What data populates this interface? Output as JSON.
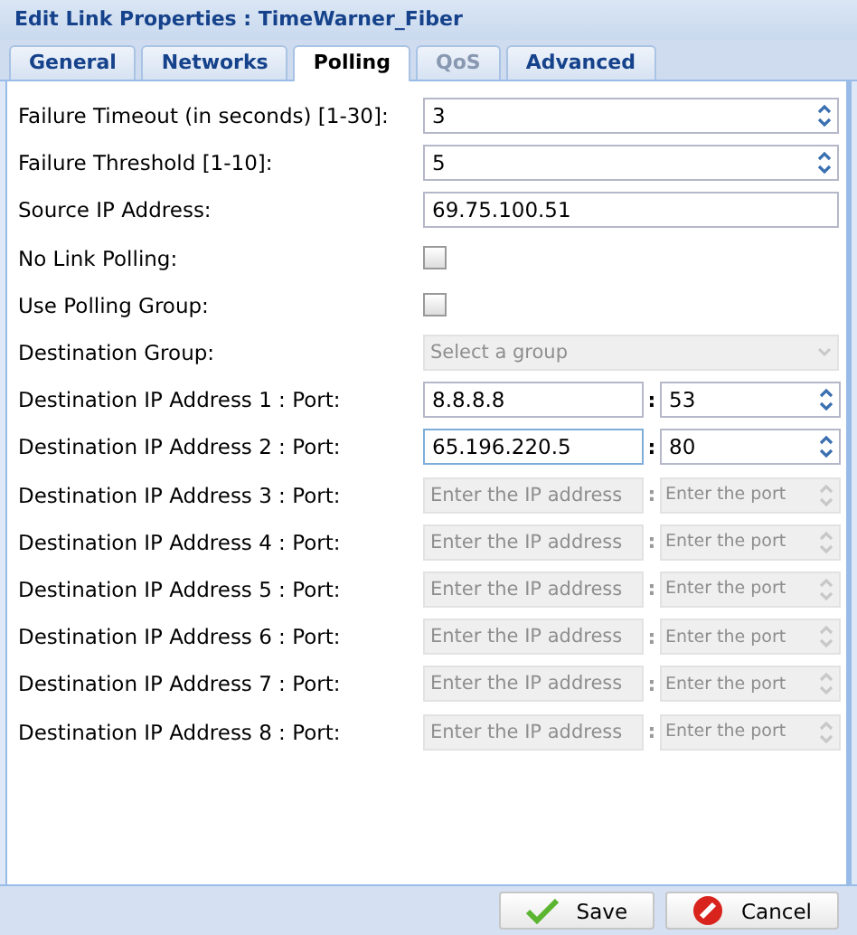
{
  "window": {
    "title": "Edit Link Properties : TimeWarner_Fiber"
  },
  "tabs": [
    {
      "label": "General",
      "selected": false,
      "disabled": false
    },
    {
      "label": "Networks",
      "selected": false,
      "disabled": false
    },
    {
      "label": "Polling",
      "selected": true,
      "disabled": false
    },
    {
      "label": "QoS",
      "selected": false,
      "disabled": true
    },
    {
      "label": "Advanced",
      "selected": false,
      "disabled": false
    }
  ],
  "fields": [
    {
      "kind": "spinner",
      "label": "Failure Timeout (in seconds) [1-30]:",
      "value": "3"
    },
    {
      "kind": "spinner",
      "label": "Failure Threshold [1-10]:",
      "value": "5"
    },
    {
      "kind": "text",
      "label": "Source IP Address:",
      "value": "69.75.100.51"
    },
    {
      "kind": "checkbox",
      "label": "No Link Polling:",
      "checked": false
    },
    {
      "kind": "checkbox",
      "label": "Use Polling Group:",
      "checked": false
    },
    {
      "kind": "select",
      "label": "Destination Group:",
      "placeholder": "Select a group",
      "disabled": true
    },
    {
      "kind": "ip-port",
      "label": "Destination IP Address 1 : Port:",
      "ip": "8.8.8.8",
      "separator": ":",
      "port": "53",
      "disabled": false,
      "focused": false
    },
    {
      "kind": "ip-port",
      "label": "Destination IP Address 2 : Port:",
      "ip": "65.196.220.5",
      "separator": ":",
      "port": "80",
      "disabled": false,
      "focused": true
    },
    {
      "kind": "ip-port",
      "label": "Destination IP Address 3 : Port:",
      "ip_placeholder": "Enter the IP address",
      "separator": ":",
      "port_placeholder": "Enter the port",
      "disabled": true,
      "focused": false
    },
    {
      "kind": "ip-port",
      "label": "Destination IP Address 4 : Port:",
      "ip_placeholder": "Enter the IP address",
      "separator": ":",
      "port_placeholder": "Enter the port",
      "disabled": true,
      "focused": false
    },
    {
      "kind": "ip-port",
      "label": "Destination IP Address 5 : Port:",
      "ip_placeholder": "Enter the IP address",
      "separator": ":",
      "port_placeholder": "Enter the port",
      "disabled": true,
      "focused": false
    },
    {
      "kind": "ip-port",
      "label": "Destination IP Address 6 : Port:",
      "ip_placeholder": "Enter the IP address",
      "separator": ":",
      "port_placeholder": "Enter the port",
      "disabled": true,
      "focused": false
    },
    {
      "kind": "ip-port",
      "label": "Destination IP Address 7 : Port:",
      "ip_placeholder": "Enter the IP address",
      "separator": ":",
      "port_placeholder": "Enter the port",
      "disabled": true,
      "focused": false
    },
    {
      "kind": "ip-port",
      "label": "Destination IP Address 8 : Port:",
      "ip_placeholder": "Enter the IP address",
      "separator": ":",
      "port_placeholder": "Enter the port",
      "disabled": true,
      "focused": false
    }
  ],
  "buttons": [
    {
      "kind": "save",
      "label": "Save"
    },
    {
      "kind": "cancel",
      "label": "Cancel"
    }
  ]
}
